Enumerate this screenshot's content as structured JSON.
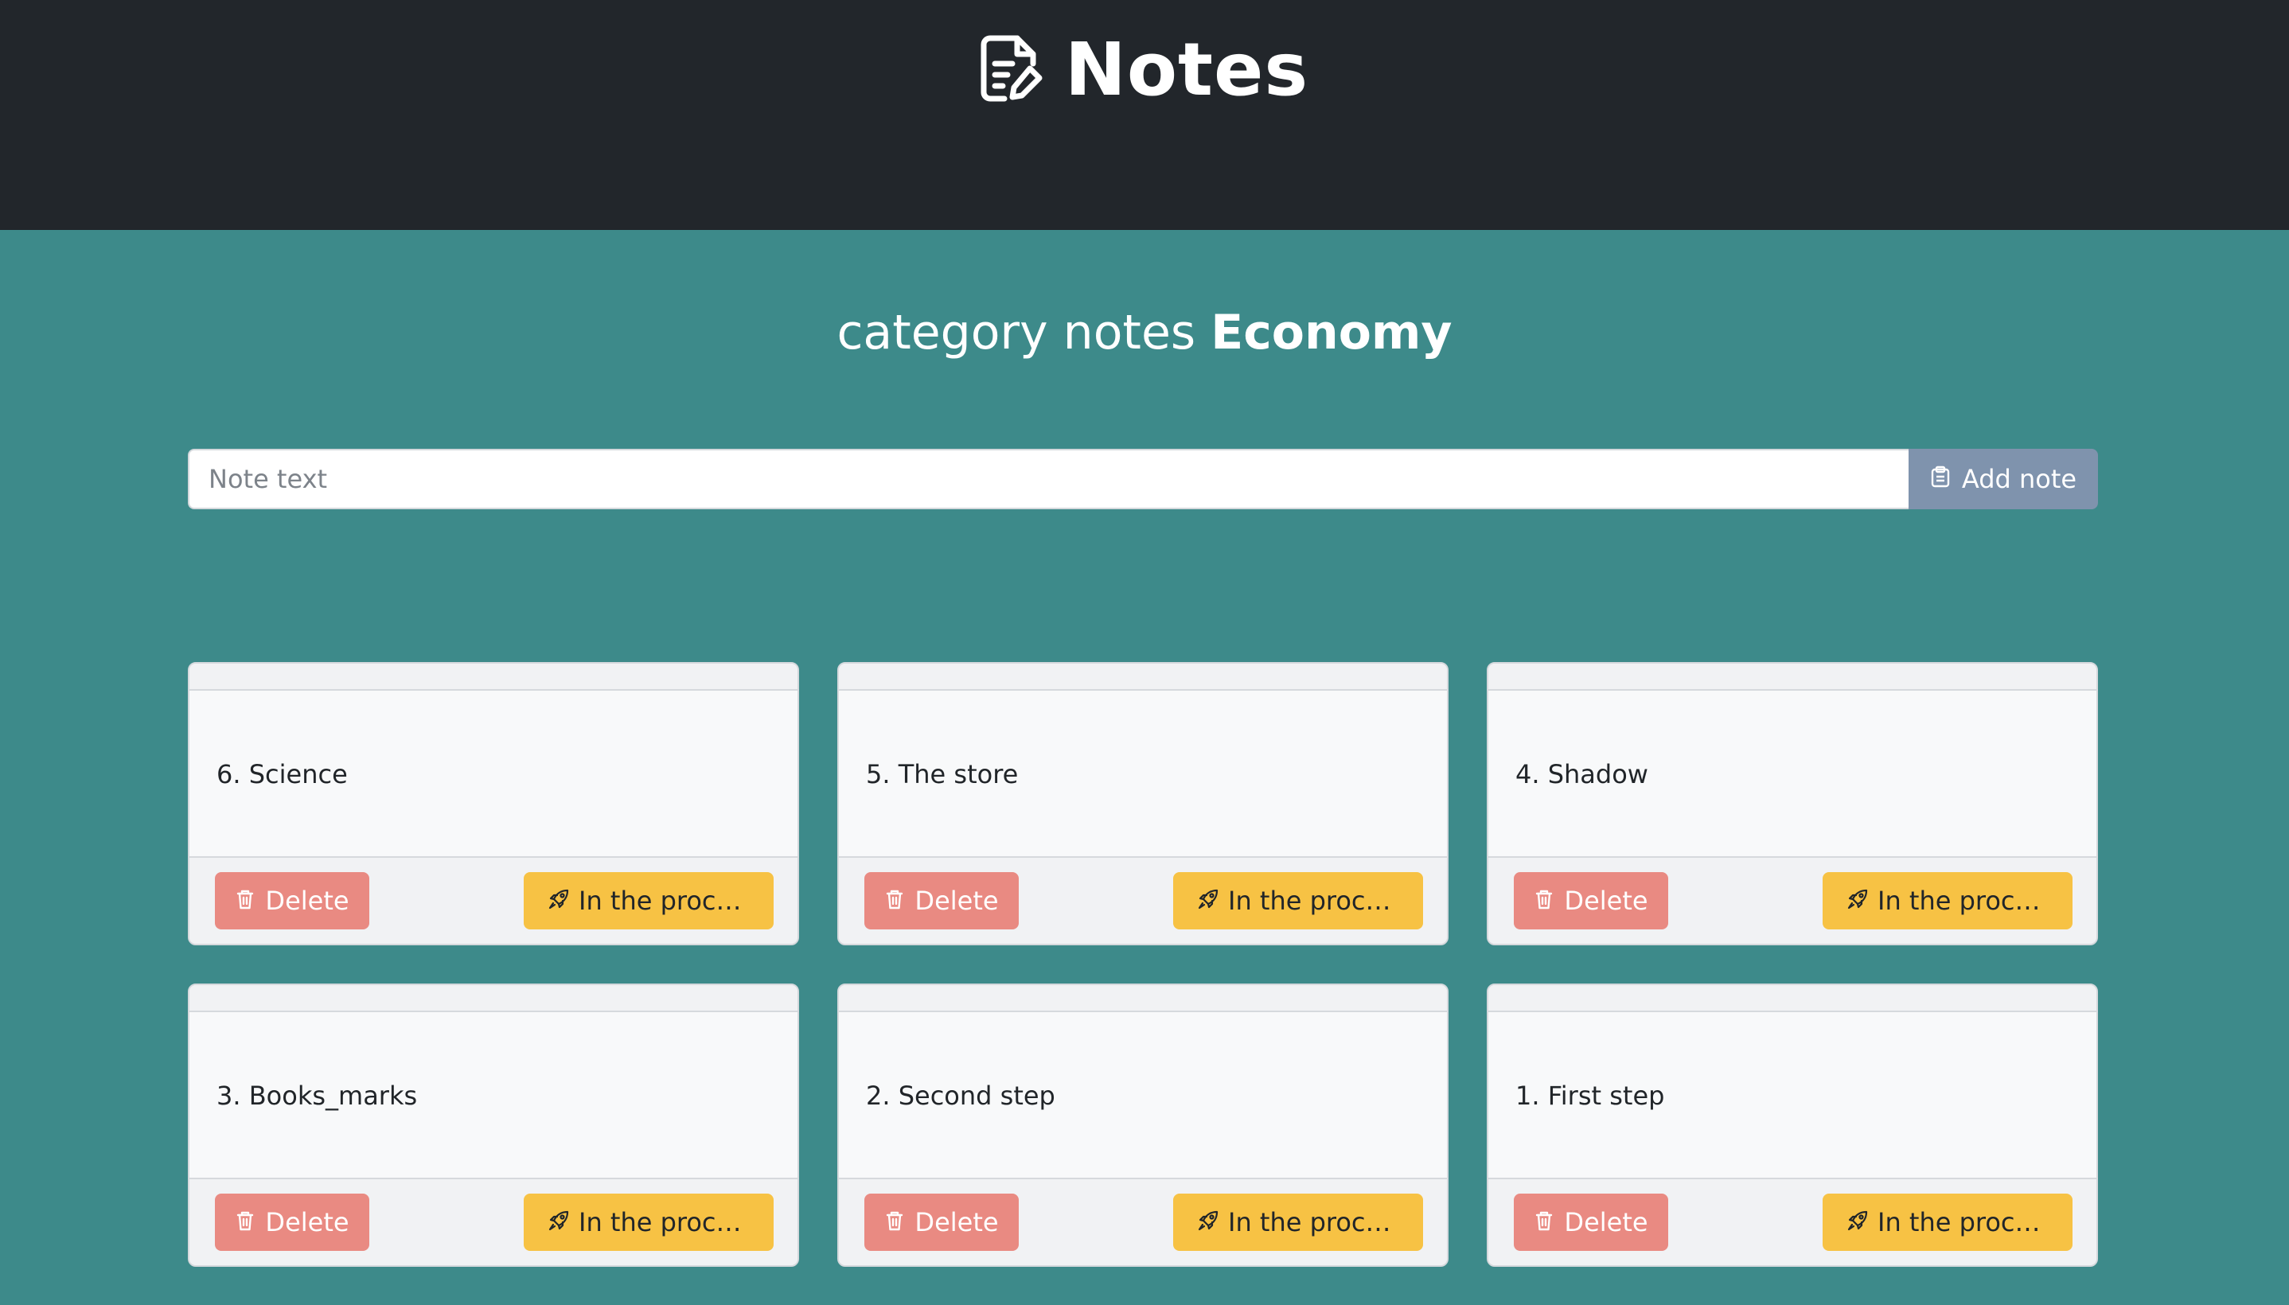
{
  "header": {
    "app_title": "Notes",
    "logo_icon": "note-pencil-icon",
    "background": "#22262b"
  },
  "page": {
    "heading_prefix": "category notes",
    "category": "Economy",
    "background": "#3d8a8a"
  },
  "add_form": {
    "placeholder": "Note text",
    "value": "",
    "button_label": "Add note",
    "button_icon": "clipboard-icon"
  },
  "notes": [
    {
      "text": "6. Science",
      "delete_label": "Delete",
      "status_label": "In the proce..."
    },
    {
      "text": "5. The store",
      "delete_label": "Delete",
      "status_label": "In the proce..."
    },
    {
      "text": "4. Shadow",
      "delete_label": "Delete",
      "status_label": "In the proce..."
    },
    {
      "text": "3. Books_marks",
      "delete_label": "Delete",
      "status_label": "In the proce..."
    },
    {
      "text": "2. Second step",
      "delete_label": "Delete",
      "status_label": "In the proce..."
    },
    {
      "text": "1. First step",
      "delete_label": "Delete",
      "status_label": "In the proce..."
    }
  ],
  "icons": {
    "delete": "trash-icon",
    "status": "rocket-icon"
  },
  "colors": {
    "delete_button": "#e98a82",
    "status_button": "#f7c244",
    "add_button": "#7f93ad"
  }
}
